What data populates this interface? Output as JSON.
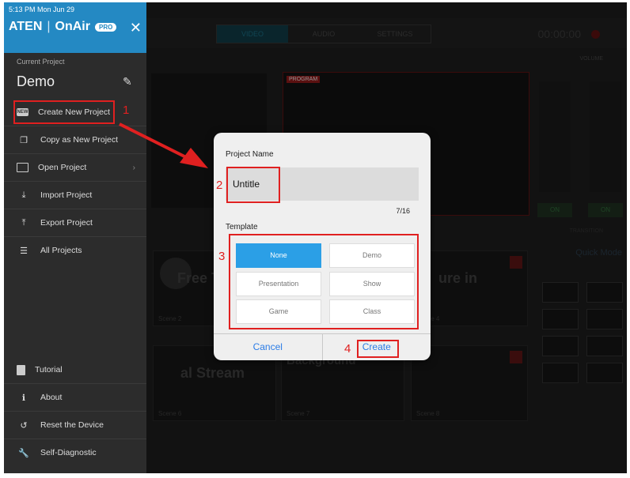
{
  "status_bar": {
    "time_date": "5:13 PM  Mon Jun 29"
  },
  "app": {
    "brand": "ATEN",
    "product": "OnAir",
    "edition": "PRO"
  },
  "sidebar": {
    "current_label": "Current Project",
    "current_name": "Demo",
    "items": [
      {
        "label": "Create New Project",
        "icon": "new-badge-icon"
      },
      {
        "label": "Copy as New Project",
        "icon": "copy-icon"
      },
      {
        "label": "Open Project",
        "icon": "folder-icon"
      },
      {
        "label": "Import Project",
        "icon": "import-icon"
      },
      {
        "label": "Export Project",
        "icon": "export-icon"
      },
      {
        "label": "All Projects",
        "icon": "list-icon"
      }
    ],
    "bottom_items": [
      {
        "label": "Tutorial",
        "icon": "book-icon"
      },
      {
        "label": "About",
        "icon": "info-icon"
      },
      {
        "label": "Reset the Device",
        "icon": "reset-icon"
      },
      {
        "label": "Self-Diagnostic",
        "icon": "wrench-icon"
      }
    ]
  },
  "background": {
    "tabs": [
      "VIDEO",
      "AUDIO",
      "SETTINGS"
    ],
    "timer": "00:00:00",
    "volume_label": "VOLUME",
    "program_label": "PROGRAM",
    "on_labels": [
      "ON",
      "ON"
    ],
    "transition_label": "TRANSITION",
    "quick_mode": "Quick Mode",
    "scenes": [
      {
        "label": "Scene 2",
        "title": "Free T"
      },
      {
        "label": "Scene 4",
        "title": "ure in"
      },
      {
        "label": "Scene 6",
        "title": "al Stream"
      },
      {
        "label": "Scene 7",
        "title": "Background"
      },
      {
        "label": "Scene 8",
        "title": ""
      }
    ]
  },
  "dialog": {
    "name_label": "Project Name",
    "name_value": "Untitle",
    "counter": "7/16",
    "template_label": "Template",
    "templates": [
      "None",
      "Demo",
      "Presentation",
      "Show",
      "Game",
      "Class"
    ],
    "selected_template": "None",
    "cancel_label": "Cancel",
    "create_label": "Create"
  },
  "annotations": [
    "1",
    "2",
    "3",
    "4"
  ],
  "colors": {
    "accent": "#2b9fe6",
    "header": "#2489c3",
    "highlight": "#e02020"
  }
}
